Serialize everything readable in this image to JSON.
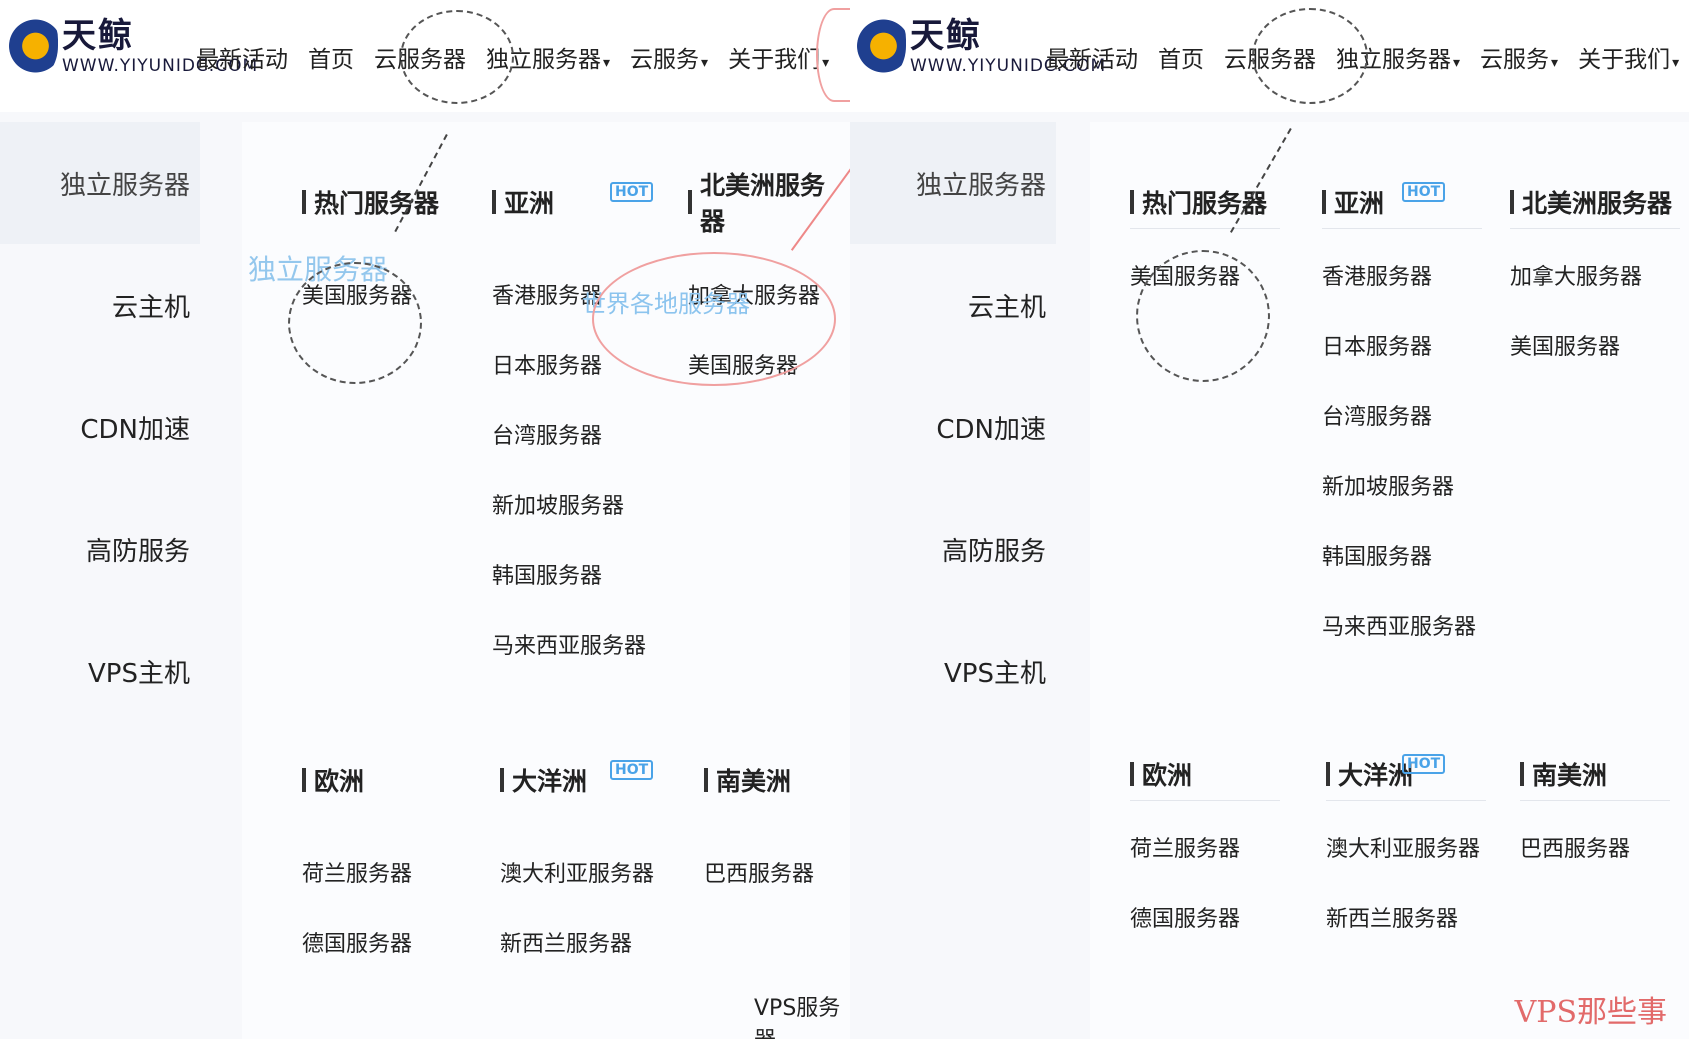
{
  "left": {
    "logo": {
      "brand": "天鲸",
      "url": "WWW.YIYUNIDC.COM"
    },
    "nav": [
      "最新活动",
      "首页",
      "云服务器",
      "独立服务器",
      "云服务",
      "关于我们"
    ],
    "sidebar": [
      "独立服务器",
      "云主机",
      "CDN加速",
      "高防服务",
      "VPS主机"
    ],
    "highlight_label": "独立服务器",
    "groups": [
      {
        "title": "热门服务器",
        "links": [
          "美国服务器"
        ]
      },
      {
        "title": "亚洲",
        "links": [
          "香港服务器",
          "日本服务器",
          "台湾服务器",
          "新加坡服务器",
          "韩国服务器",
          "马来西亚服务器"
        ]
      },
      {
        "title": "北美洲服务器",
        "links": [
          "加拿大服务器",
          "美国服务器"
        ]
      },
      {
        "title": "欧洲",
        "links": [
          "荷兰服务器",
          "德国服务器"
        ]
      },
      {
        "title": "大洋洲",
        "links": [
          "澳大利亚服务器",
          "新西兰服务器"
        ]
      },
      {
        "title": "南美洲",
        "links": [
          "巴西服务器"
        ]
      }
    ],
    "watermark_text": "世界各地服务器",
    "footer_text": "VPS服务器"
  },
  "right": {
    "logo": {
      "brand": "天鲸",
      "url": "WWW.YIYUNIDC.COM"
    },
    "nav": [
      "最新活动",
      "首页",
      "云服务器",
      "独立服务器",
      "云服务",
      "关于我们"
    ],
    "sidebar": [
      "独立服务器",
      "云主机",
      "CDN加速",
      "高防服务",
      "VPS主机"
    ],
    "groups": [
      {
        "title": "热门服务器",
        "links": [
          "美国服务器"
        ]
      },
      {
        "title": "亚洲",
        "links": [
          "香港服务器",
          "日本服务器",
          "台湾服务器",
          "新加坡服务器",
          "韩国服务器",
          "马来西亚服务器"
        ]
      },
      {
        "title": "北美洲服务器",
        "links": [
          "加拿大服务器",
          "美国服务器"
        ]
      },
      {
        "title": "欧洲",
        "links": [
          "荷兰服务器",
          "德国服务器"
        ]
      },
      {
        "title": "大洋洲",
        "links": [
          "澳大利亚服务器",
          "新西兰服务器"
        ]
      },
      {
        "title": "南美洲",
        "links": [
          "巴西服务器"
        ]
      }
    ]
  },
  "hot_badge": "HOT",
  "watermark": "VPS那些事",
  "colors": {
    "accent": "#4aa3e8",
    "red_annotation": "#f0a0a0",
    "watermark": "#e26a6a",
    "logo_yellow": "#f6b100",
    "logo_blue": "#1f3f8f"
  }
}
